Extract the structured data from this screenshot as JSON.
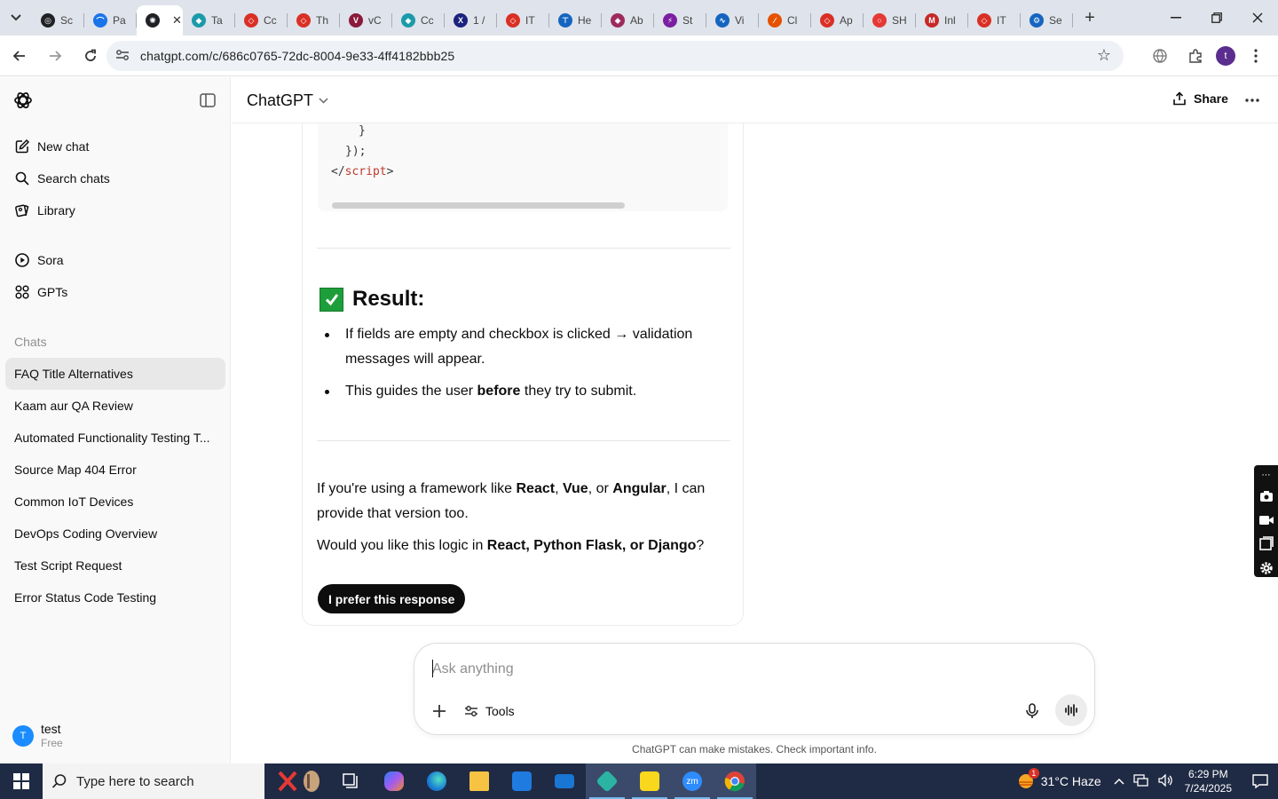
{
  "browser": {
    "tabs": [
      {
        "label": "Sc",
        "fav_color": "#202124",
        "fav_char": "◎"
      },
      {
        "label": "Pa",
        "fav_color": "#1a73e8",
        "fav_char": "⌒"
      },
      {
        "label": "",
        "fav_color": "#202124",
        "fav_char": "✺",
        "active": true
      },
      {
        "label": "Ta",
        "fav_color": "#1b9aaa",
        "fav_char": "◆"
      },
      {
        "label": "Cc",
        "fav_color": "#d93025",
        "fav_char": "◇"
      },
      {
        "label": "Th",
        "fav_color": "#d93025",
        "fav_char": "◇"
      },
      {
        "label": "vC",
        "fav_color": "#8b1a3a",
        "fav_char": "V"
      },
      {
        "label": "Cc",
        "fav_color": "#1b9aaa",
        "fav_char": "◆"
      },
      {
        "label": "1 /",
        "fav_color": "#1a237e",
        "fav_char": "X"
      },
      {
        "label": "IT",
        "fav_color": "#d93025",
        "fav_char": "◇"
      },
      {
        "label": "He",
        "fav_color": "#1565c0",
        "fav_char": "⊤"
      },
      {
        "label": "Ab",
        "fav_color": "#9c2b5d",
        "fav_char": "⬥"
      },
      {
        "label": "St",
        "fav_color": "#7b1fa2",
        "fav_char": "⚡"
      },
      {
        "label": "Vi",
        "fav_color": "#1565c0",
        "fav_char": "∿"
      },
      {
        "label": "Cl",
        "fav_color": "#e65100",
        "fav_char": "∕"
      },
      {
        "label": "Ap",
        "fav_color": "#d93025",
        "fav_char": "◇"
      },
      {
        "label": "SH",
        "fav_color": "#e53935",
        "fav_char": "○"
      },
      {
        "label": "Inl",
        "fav_color": "#c62828",
        "fav_char": "M"
      },
      {
        "label": "IT",
        "fav_color": "#d93025",
        "fav_char": "◇"
      },
      {
        "label": "Se",
        "fav_color": "#1565c0",
        "fav_char": "⚙"
      }
    ],
    "url": "chatgpt.com/c/686c0765-72dc-8004-9e33-4ff4182bbb25",
    "profile_initial": "t"
  },
  "sidebar": {
    "nav": [
      {
        "label": "New chat",
        "icon": "compose-icon"
      },
      {
        "label": "Search chats",
        "icon": "search-icon"
      },
      {
        "label": "Library",
        "icon": "library-icon"
      }
    ],
    "nav2": [
      {
        "label": "Sora",
        "icon": "play-circle-icon"
      },
      {
        "label": "GPTs",
        "icon": "grid-icon"
      }
    ],
    "section_title": "Chats",
    "chats": [
      "FAQ Title Alternatives",
      "Kaam aur QA Review",
      "Automated Functionality Testing T...",
      "Source Map 404 Error",
      "Common IoT Devices",
      "DevOps Coding Overview",
      "Test Script Request",
      "Error Status Code Testing"
    ],
    "active_chat_index": 0,
    "user": {
      "initial": "T",
      "name": "test",
      "plan": "Free"
    }
  },
  "header": {
    "model": "ChatGPT",
    "share_label": "Share"
  },
  "response": {
    "code_lines": [
      "}",
      "});"
    ],
    "code_close_tag": {
      "open": "</",
      "name": "script",
      "close": ">"
    },
    "result_heading": "Result:",
    "bullets": [
      "If fields are empty and checkbox is clicked → validation messages will appear.",
      {
        "pre": "This guides the user ",
        "bold": "before",
        "post": " they try to submit."
      }
    ],
    "para1": {
      "pre": "If you're using a framework like ",
      "b1": "React",
      "m1": ", ",
      "b2": "Vue",
      "m2": ", or ",
      "b3": "Angular",
      "post": ", I can provide that version too."
    },
    "para2": {
      "pre": "Would you like this logic in ",
      "bold": "React, Python Flask, or Django",
      "post": "?"
    },
    "prefer_label": "I prefer this response"
  },
  "composer": {
    "placeholder": "Ask anything",
    "tools_label": "Tools",
    "disclaimer": "ChatGPT can make mistakes. Check important info."
  },
  "taskbar": {
    "search_placeholder": "Type here to search",
    "weather": "31°C  Haze",
    "weather_badge": "1",
    "time": "6:29 PM",
    "date": "7/24/2025"
  }
}
